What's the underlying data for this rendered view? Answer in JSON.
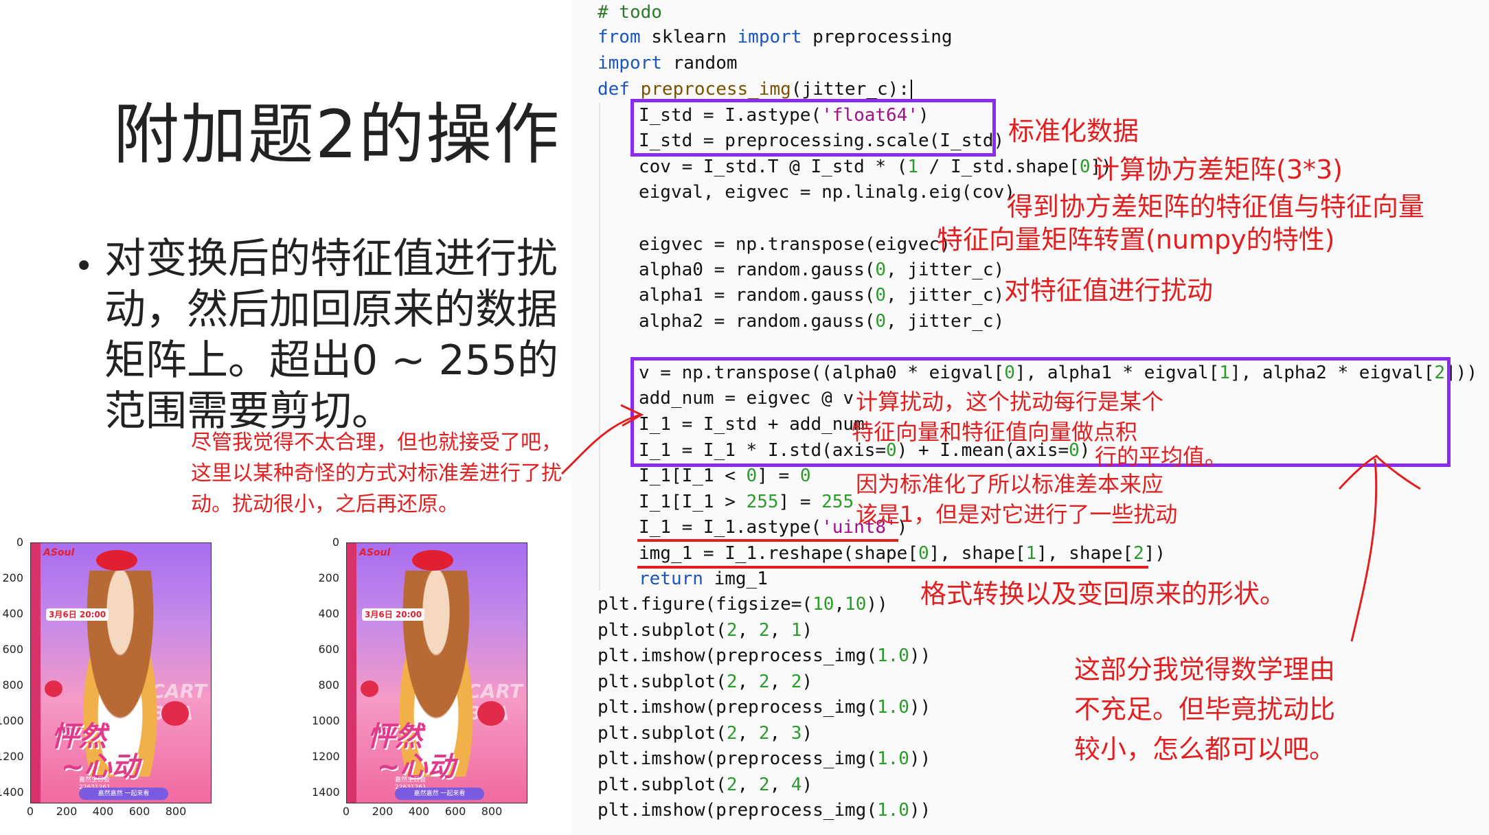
{
  "slide": {
    "title": "附加题2的操作",
    "bullet": "对变换后的特征值进行扰动，然后加回原来的数据矩阵上。超出0 ~ 255的范围需要剪切。",
    "note": "尽管我觉得不太合理，但也就接受了吧，这里以某种奇怪的方式对标准差进行了扰动。扰动很小，之后再还原。"
  },
  "code": {
    "l1": "# todo",
    "l2_a": "from",
    "l2_b": " sklearn ",
    "l2_c": "import",
    "l2_d": " preprocessing",
    "l3_a": "import",
    "l3_b": " random",
    "l4_a": "def",
    "l4_b": " preprocess_img",
    "l4_c": "(jitter_c):",
    "l5_a": "I_std = I.astype(",
    "l5_b": "'float64'",
    "l5_c": ")",
    "l6": "I_std = preprocessing.scale(I_std)",
    "l7_a": "cov = I_std.T @ I_std * (",
    "l7_b": "1",
    "l7_c": " / I_std.shape[",
    "l7_d": "0",
    "l7_e": "])",
    "l8": "eigval, eigvec = np.linalg.eig(cov)",
    "l9": "eigvec = np.transpose(eigvec)",
    "l10_a": "alpha0 = random.gauss(",
    "l10_b": "0",
    "l10_c": ", jitter_c)",
    "l11_a": "alpha1 = random.gauss(",
    "l11_b": "0",
    "l11_c": ", jitter_c)",
    "l12_a": "alpha2 = random.gauss(",
    "l12_b": "0",
    "l12_c": ", jitter_c)",
    "l13_a": "v = np.transpose((alpha0 * eigval[",
    "l13_b": "0",
    "l13_c": "], alpha1 * eigval[",
    "l13_d": "1",
    "l13_e": "], alpha2 * eigval[",
    "l13_f": "2",
    "l13_g": "]))",
    "l14": "add_num = eigvec @ v",
    "l15": "I_1 = I_std + add_num",
    "l16_a": "I_1 = I_1 * I.std(axis=",
    "l16_b": "0",
    "l16_c": ") + I.mean(axis=",
    "l16_d": "0",
    "l16_e": ")",
    "l17_a": "I_1[I_1 < ",
    "l17_b": "0",
    "l17_c": "] = ",
    "l17_d": "0",
    "l18_a": "I_1[I_1 > ",
    "l18_b": "255",
    "l18_c": "] = ",
    "l18_d": "255",
    "l19_a": "I_1 = I_1.astype(",
    "l19_b": "'uint8'",
    "l19_c": ")",
    "l20_a": "img_1 = I_1.reshape(shape[",
    "l20_b": "0",
    "l20_c": "], shape[",
    "l20_d": "1",
    "l20_e": "], shape[",
    "l20_f": "2",
    "l20_g": "])",
    "l21_a": "return",
    "l21_b": " img_1",
    "l22_a": "plt.figure(figsize=(",
    "l22_b": "10",
    "l22_c": ",",
    "l22_d": "10",
    "l22_e": "))",
    "l23_a": "plt.subplot(",
    "l23_b": "2",
    "l23_c": ", ",
    "l23_d": "2",
    "l23_e": ", ",
    "l23_f": "1",
    "l23_g": ")",
    "l24_a": "plt.imshow(preprocess_img(",
    "l24_b": "1.0",
    "l24_c": "))",
    "l25_f": "2",
    "l27_f": "3",
    "l29_f": "4"
  },
  "annotations": {
    "a1": "标准化数据",
    "a2": "计算协方差矩阵(3*3)",
    "a3": "得到协方差矩阵的特征值与特征向量",
    "a4": "特征向量矩阵转置(numpy的特性)",
    "a5": "对特征值进行扰动",
    "a6": "计算扰动，这个扰动每行是某个",
    "a7": "特征向量和特征值向量做点积",
    "a8": "行的平均值。",
    "a9": "因为标准化了所以标准差本来应",
    "a10": "该是1，但是对它进行了一些扰动",
    "a11": "格式转换以及变回原来的形状。",
    "a12": "这部分我觉得数学理由",
    "a13": "不充足。但毕竟扰动比",
    "a14": "较小，怎么都可以吧。"
  },
  "plots": {
    "y_ticks": [
      "0",
      "200",
      "400",
      "600",
      "800",
      "1000",
      "1200",
      "1400"
    ],
    "x_ticks": [
      "0",
      "200",
      "400",
      "600",
      "800"
    ],
    "poster": {
      "logo": "ASoul",
      "date": "3月6日 20:00",
      "slogan_1": "怦然",
      "slogan_2": "心动",
      "watermark_1": "CART",
      "watermark_2": "BEA",
      "info_1": "嘉然生日会",
      "info_2": "22631261",
      "button": "嘉然嘉然 一起来看"
    }
  },
  "colors": {
    "annotation": "#e02020",
    "box": "#8b2bf0",
    "keyword": "#1a55c0",
    "string": "#a0108a",
    "number": "#2a9b2a",
    "comment": "#2c7a2c"
  }
}
